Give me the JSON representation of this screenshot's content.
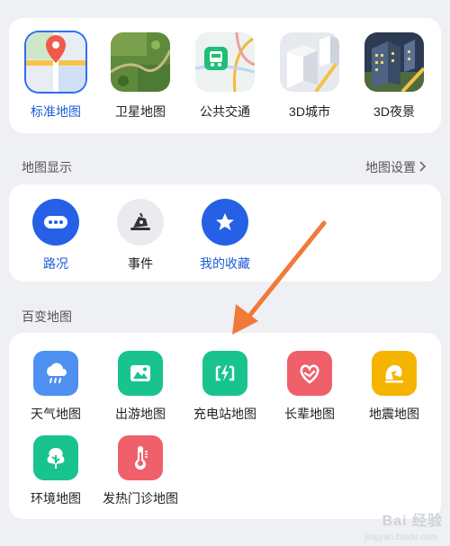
{
  "layers": [
    {
      "label": "标准地图",
      "icon": "standard-map-icon",
      "selected": true
    },
    {
      "label": "卫星地图",
      "icon": "satellite-map-icon",
      "selected": false
    },
    {
      "label": "公共交通",
      "icon": "public-transit-icon",
      "selected": false
    },
    {
      "label": "3D城市",
      "icon": "3d-city-icon",
      "selected": false
    },
    {
      "label": "3D夜景",
      "icon": "3d-night-icon",
      "selected": false
    }
  ],
  "display_section": {
    "title": "地图显示",
    "settings_link": "地图设置",
    "items": [
      {
        "label": "路况",
        "icon": "traffic-icon",
        "color": "#2560e6"
      },
      {
        "label": "事件",
        "icon": "event-icon",
        "color": "#e9ebee"
      },
      {
        "label": "我的收藏",
        "icon": "star-icon",
        "color": "#2560e6"
      }
    ]
  },
  "variety_section": {
    "title": "百变地图",
    "items": [
      {
        "label": "天气地图",
        "icon": "weather-icon",
        "color": "#4e8ff2"
      },
      {
        "label": "出游地图",
        "icon": "travel-icon",
        "color": "#19c38e"
      },
      {
        "label": "充电站地图",
        "icon": "charging-station-icon",
        "color": "#19c38e"
      },
      {
        "label": "长辈地图",
        "icon": "elder-heart-icon",
        "color": "#f0606a"
      },
      {
        "label": "地震地图",
        "icon": "earthquake-icon",
        "color": "#f5b400"
      },
      {
        "label": "环境地图",
        "icon": "environment-tree-icon",
        "color": "#19c38e"
      },
      {
        "label": "发热门诊地图",
        "icon": "fever-thermometer-icon",
        "color": "#f0606a"
      }
    ]
  },
  "accent_color": "#1f5bd6",
  "annotation_arrow_color": "#f07a3a",
  "watermark": "Bai 经验",
  "watermark_sub": "jingyan.baidu.com"
}
